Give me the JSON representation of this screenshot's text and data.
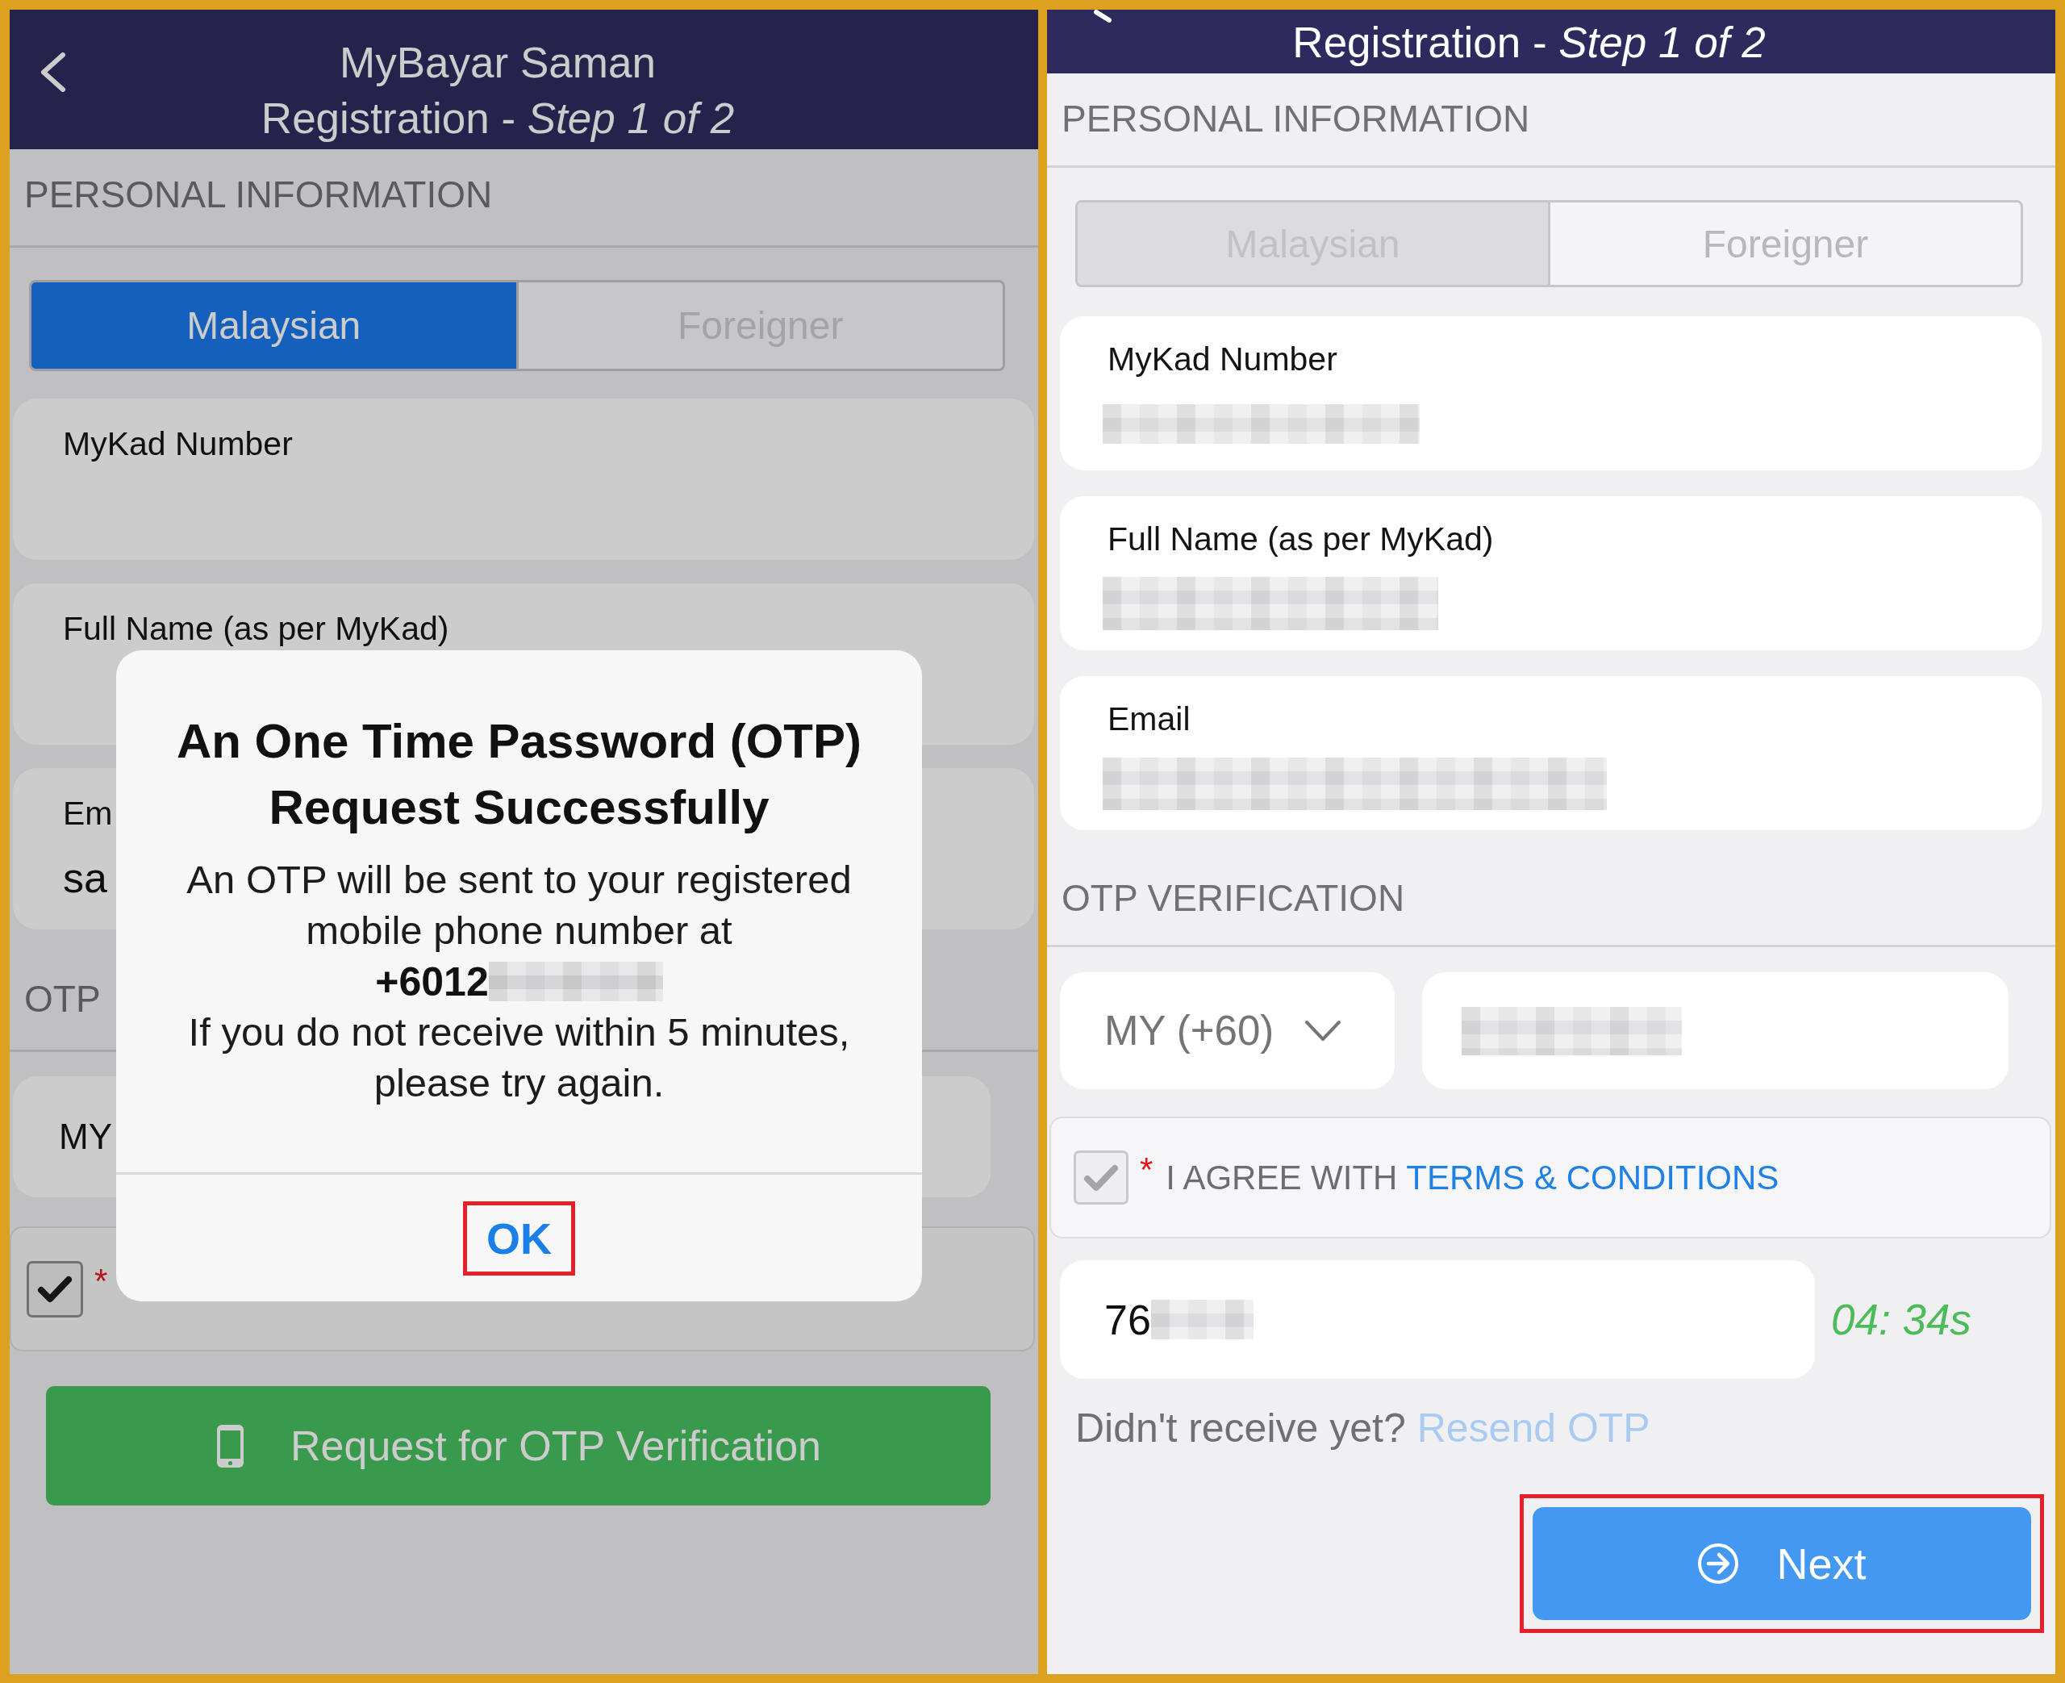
{
  "screens": [
    {
      "header": {
        "title": "MyBayar Saman",
        "subtitle": "Registration - *Step 1 of 2*"
      },
      "personal_information": {
        "heading": "PERSONAL INFORMATION",
        "nationality": {
          "disabled": false,
          "options": [
            {
              "label": "Malaysian",
              "selected": true
            },
            {
              "label": "Foreigner",
              "selected": false
            }
          ]
        },
        "fields": [
          {
            "label": "MyKad Number",
            "redacted": false
          },
          {
            "label": "Full Name (as per MyKad)",
            "redacted": false
          },
          {
            "label": "Em",
            "value": "sa",
            "redacted": false
          }
        ]
      },
      "otp_verification": {
        "heading": "OTP",
        "country_code": "MY",
        "phone": {
          "redacted": false
        },
        "agreement": {
          "checked": true,
          "disabled": false,
          "required_mark": "*"
        },
        "request_button": {
          "label": "Request for OTP Verification"
        }
      },
      "dialog": {
        "title": "An One Time Password (OTP) Request Successfully",
        "message": "An OTP will be sent to your registered mobile phone number at",
        "phone": "+6012",
        "phone_redacted": true,
        "note": "If you do not receive within 5 minutes, please try again.",
        "button": {
          "label": "OK",
          "highlighted": true
        }
      }
    },
    {
      "header": {
        "subtitle": "Registration - *Step 1 of 2*"
      },
      "personal_information": {
        "heading": "PERSONAL INFORMATION",
        "nationality": {
          "disabled": true,
          "options": [
            {
              "label": "Malaysian",
              "selected": true
            },
            {
              "label": "Foreigner",
              "selected": false
            }
          ]
        },
        "fields": [
          {
            "label": "MyKad Number",
            "redacted": true
          },
          {
            "label": "Full Name (as per MyKad)",
            "redacted": true
          },
          {
            "label": "Email",
            "redacted": true
          }
        ]
      },
      "otp_verification": {
        "heading": "OTP VERIFICATION",
        "country_code": "MY (+60)",
        "phone": {
          "redacted": true
        },
        "agreement": {
          "checked": true,
          "disabled": true,
          "required_mark": "*",
          "text": "I AGREE WITH",
          "link": "TERMS & CONDITIONS"
        },
        "otp_code": {
          "value": "76",
          "redacted": true
        },
        "timer": "04: 34s",
        "resend": {
          "prompt": "Didn't receive yet?",
          "link": "Resend OTP",
          "disabled": true
        },
        "next_button": {
          "label": "Next",
          "highlighted": true
        }
      }
    }
  ]
}
